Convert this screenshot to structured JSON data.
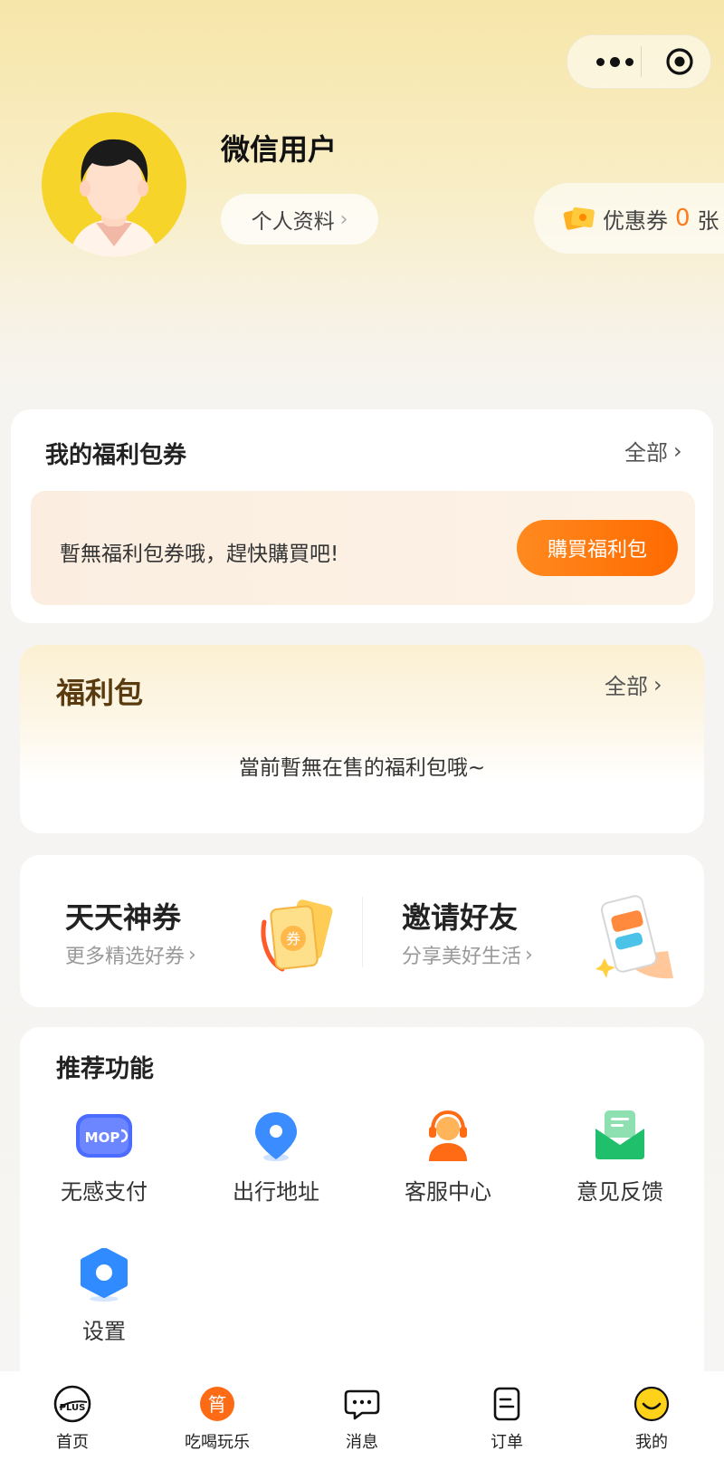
{
  "header": {
    "username": "微信用户",
    "profile_button": "个人资料",
    "coupon_label": "优惠券",
    "coupon_count": "0",
    "coupon_unit": "张"
  },
  "voucher_section": {
    "title": "我的福利包券",
    "more": "全部",
    "empty_text": "暫無福利包券哦，趕快購買吧!",
    "buy_button": "購買福利包"
  },
  "package_section": {
    "title": "福利包",
    "more": "全部",
    "empty_text": "當前暫無在售的福利包哦~"
  },
  "promos": [
    {
      "title": "天天神券",
      "subtitle": "更多精选好券",
      "icon": "coupon-ticket-icon"
    },
    {
      "title": "邀请好友",
      "subtitle": "分享美好生活",
      "icon": "phone-share-icon"
    }
  ],
  "features": {
    "title": "推荐功能",
    "items": [
      {
        "label": "无感支付",
        "icon": "mop-pay-icon",
        "badge": "MOP"
      },
      {
        "label": "出行地址",
        "icon": "location-pin-icon"
      },
      {
        "label": "客服中心",
        "icon": "customer-service-icon"
      },
      {
        "label": "意见反馈",
        "icon": "feedback-mail-icon"
      },
      {
        "label": "设置",
        "icon": "settings-hex-icon"
      }
    ]
  },
  "tabbar": {
    "items": [
      {
        "label": "首页",
        "icon": "plus-home-icon"
      },
      {
        "label": "吃喝玩乐",
        "icon": "food-badge-icon",
        "badge": "筲"
      },
      {
        "label": "消息",
        "icon": "message-bubble-icon"
      },
      {
        "label": "订单",
        "icon": "order-doc-icon"
      },
      {
        "label": "我的",
        "icon": "smiley-icon"
      }
    ]
  },
  "colors": {
    "accent": "#ff7a1a",
    "header_bg": "#f7e6a9",
    "package_title": "#5a3b10"
  }
}
